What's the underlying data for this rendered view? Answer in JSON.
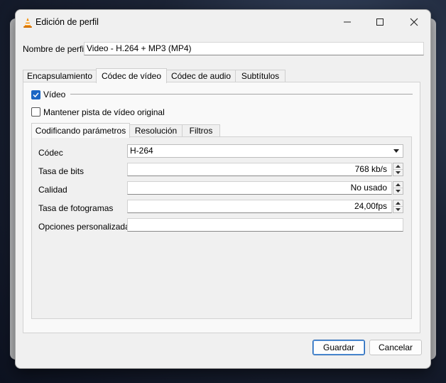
{
  "window": {
    "title": "Edición de perfil"
  },
  "profile": {
    "label": "Nombre de perfil",
    "value": "Video - H.264 + MP3 (MP4)"
  },
  "tabs": [
    {
      "label": "Encapsulamiento",
      "active": false
    },
    {
      "label": "Códec de vídeo",
      "active": true
    },
    {
      "label": "Códec de audio",
      "active": false
    },
    {
      "label": "Subtítulos",
      "active": false
    }
  ],
  "video": {
    "enabled_label": "Vídeo",
    "enabled": true,
    "keep_label": "Mantener pista de vídeo original",
    "keep": false
  },
  "subtabs": [
    {
      "label": "Codificando parámetros",
      "active": true
    },
    {
      "label": "Resolución",
      "active": false
    },
    {
      "label": "Filtros",
      "active": false
    }
  ],
  "params": {
    "codec_label": "Códec",
    "codec_value": "H-264",
    "bitrate_label": "Tasa de bits",
    "bitrate_value": "768 kb/s",
    "quality_label": "Calidad",
    "quality_value": "No usado",
    "framerate_label": "Tasa de fotogramas",
    "framerate_value": "24,00fps",
    "custom_label": "Opciones personalizadas",
    "custom_value": ""
  },
  "buttons": {
    "save": "Guardar",
    "cancel": "Cancelar"
  },
  "colors": {
    "accent": "#1a66c4",
    "vlc_orange": "#f08a00"
  }
}
